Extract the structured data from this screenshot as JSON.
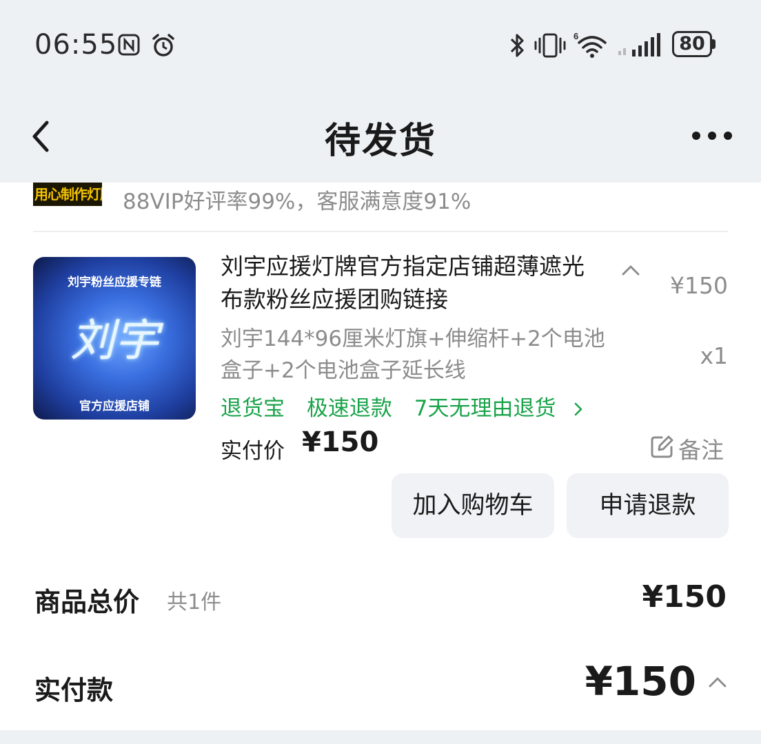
{
  "status_bar": {
    "time": "06:55",
    "battery": "80",
    "icons": [
      "nfc-icon",
      "alarm-icon",
      "bluetooth-icon",
      "vibrate-icon",
      "wifi-6-icon",
      "signal-icon",
      "battery-icon"
    ]
  },
  "nav": {
    "title": "待发货",
    "back_icon": "chevron-left-icon",
    "more_icon": "more-dots-icon"
  },
  "shop": {
    "thumb_text": "用心制作灯牌",
    "rating": "88VIP好评率99%，客服满意度91%"
  },
  "product": {
    "image": {
      "top_text": "刘宇粉丝应援专链",
      "main_text": "刘宇",
      "bottom_text": "官方应援店铺"
    },
    "title": "刘宇应援灯牌官方指定店铺超薄遮光布款粉丝应援团购链接",
    "spec": "刘宇144*96厘米灯旗+伸缩杆+2个电池盒子+2个电池盒子延长线",
    "price": "¥150",
    "quantity": "x1",
    "services": [
      "退货宝",
      "极速退款",
      "7天无理由退货"
    ],
    "paid_label": "实付价",
    "paid_value": "¥150",
    "note_label": "备注"
  },
  "actions": {
    "add_to_cart": "加入购物车",
    "refund": "申请退款"
  },
  "summary": {
    "total_label": "商品总价",
    "total_count": "共1件",
    "total_value": "¥150",
    "pay_label": "实付款",
    "pay_value": "¥150"
  },
  "colors": {
    "service_green": "#1aa34a",
    "muted_gray": "#8c8c8c",
    "background": "#f3f5f8"
  }
}
